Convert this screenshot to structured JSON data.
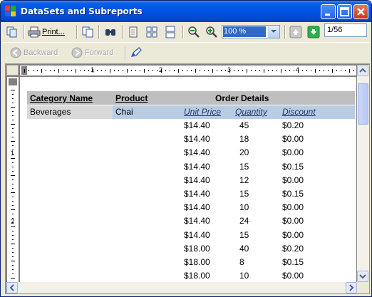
{
  "window": {
    "title": "DataSets and Subreports"
  },
  "toolbar": {
    "print_label": "Print...",
    "zoom_value": "100 %",
    "page_value": "1/56",
    "backward_label": "Backward",
    "forward_label": "Forward"
  },
  "ruler": {
    "h_labels": [
      "1",
      "2",
      "3",
      "4"
    ],
    "v_labels": [
      "1",
      "2"
    ]
  },
  "report": {
    "headers": {
      "category": "Category Name",
      "product": "Product",
      "order_details": "Order Details"
    },
    "category_value": "Beverages",
    "product_value": "Chai",
    "sub_headers": {
      "unit_price": "Unit Price",
      "quantity": "Quantity",
      "discount": "Discount"
    },
    "rows": [
      {
        "price": "$14.40",
        "qty": "45",
        "discount": "$0.20"
      },
      {
        "price": "$14.40",
        "qty": "18",
        "discount": "$0.00"
      },
      {
        "price": "$14.40",
        "qty": "20",
        "discount": "$0.00"
      },
      {
        "price": "$14.40",
        "qty": "15",
        "discount": "$0.15"
      },
      {
        "price": "$14.40",
        "qty": "12",
        "discount": "$0.00"
      },
      {
        "price": "$14.40",
        "qty": "15",
        "discount": "$0.15"
      },
      {
        "price": "$14.40",
        "qty": "10",
        "discount": "$0.00"
      },
      {
        "price": "$14.40",
        "qty": "24",
        "discount": "$0.00"
      },
      {
        "price": "$14.40",
        "qty": "15",
        "discount": "$0.00"
      },
      {
        "price": "$18.00",
        "qty": "40",
        "discount": "$0.20"
      },
      {
        "price": "$18.00",
        "qty": "8",
        "discount": "$0.15"
      },
      {
        "price": "$18.00",
        "qty": "10",
        "discount": "$0.00"
      }
    ]
  },
  "icons": [
    "app-icon",
    "minimize-icon",
    "maximize-icon",
    "close-icon",
    "copy-icon",
    "printer-icon",
    "pages-icon",
    "find-icon",
    "single-page-icon",
    "multi-page-icon",
    "continuous-icon",
    "zoom-out-icon",
    "zoom-in-icon",
    "page-up-icon",
    "page-down-icon",
    "back-arrow-icon",
    "forward-arrow-icon",
    "edit-icon"
  ],
  "colors": {
    "titlebar": "#0054e3",
    "header_band": "#bfbfbf",
    "category_band": "#d9d9d9",
    "product_band": "#b8cce4"
  }
}
